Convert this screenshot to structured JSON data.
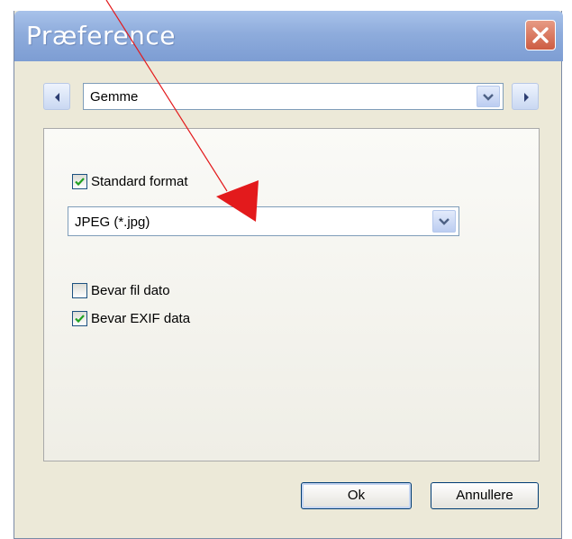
{
  "window": {
    "title": "Præference"
  },
  "nav": {
    "selected": "Gemme"
  },
  "panel": {
    "standard_format": {
      "label": "Standard format",
      "checked": true
    },
    "format_select": {
      "value": "JPEG (*.jpg)"
    },
    "keep_file_date": {
      "label": "Bevar fil dato",
      "checked": false
    },
    "keep_exif": {
      "label": "Bevar EXIF data",
      "checked": true
    }
  },
  "buttons": {
    "ok": "Ok",
    "cancel": "Annullere"
  },
  "colors": {
    "title_bar": "#8eacdc",
    "close_button": "#cd5c43",
    "check": "#21a121",
    "annotation": "#e31a1c"
  }
}
